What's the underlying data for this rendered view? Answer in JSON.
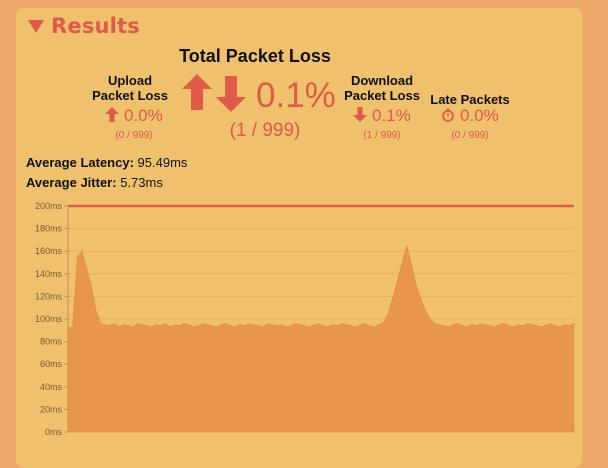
{
  "results": {
    "title": "Results"
  },
  "upload": {
    "label_line1": "Upload",
    "label_line2": "Packet Loss",
    "value": "0.0%",
    "sub": "(0 / 999)"
  },
  "total": {
    "title": "Total Packet Loss",
    "value": "0.1%",
    "sub": "(1 / 999)"
  },
  "download": {
    "label_line1": "Download",
    "label_line2": "Packet Loss",
    "value": "0.1%",
    "sub": "(1 / 999)"
  },
  "late": {
    "label": "Late Packets",
    "value": "0.0%",
    "sub": "(0 / 999)"
  },
  "metrics": {
    "latency_label": "Average Latency:",
    "latency_value": "95.49ms",
    "jitter_label": "Average Jitter:",
    "jitter_value": "5.73ms"
  },
  "colors": {
    "accent": "#e05a4a",
    "area": "#e8964a",
    "panel": "#efc16d",
    "background": "#eea86a"
  },
  "chart_data": {
    "type": "area",
    "ylim": [
      0,
      200
    ],
    "y_ticks": [
      "0ms",
      "20ms",
      "40ms",
      "60ms",
      "80ms",
      "100ms",
      "120ms",
      "140ms",
      "160ms",
      "180ms",
      "200ms"
    ],
    "reference_line": 200,
    "grid": true,
    "series": [
      {
        "values": [
          92,
          93,
          155,
          160,
          145,
          130,
          108,
          96,
          95,
          94,
          96,
          93,
          95,
          94,
          93,
          96,
          95,
          94,
          93,
          95,
          94,
          96,
          93,
          95,
          94,
          96,
          95,
          93,
          94,
          96,
          95,
          94,
          93,
          95,
          96,
          94,
          93,
          95,
          94,
          96,
          95,
          94,
          93,
          96,
          95,
          94,
          95,
          93,
          94,
          96,
          95,
          94,
          93,
          95,
          96,
          94,
          93,
          95,
          94,
          96,
          95,
          94,
          93,
          95,
          96,
          94,
          93,
          95,
          97,
          105,
          120,
          135,
          150,
          165,
          148,
          130,
          118,
          108,
          100,
          96,
          95,
          94,
          93,
          95,
          96,
          94,
          93,
          95,
          94,
          96,
          95,
          94,
          93,
          95,
          96,
          94,
          93,
          95,
          94,
          96,
          95,
          94,
          93,
          95,
          96,
          94,
          93,
          95,
          94,
          96
        ]
      }
    ]
  }
}
